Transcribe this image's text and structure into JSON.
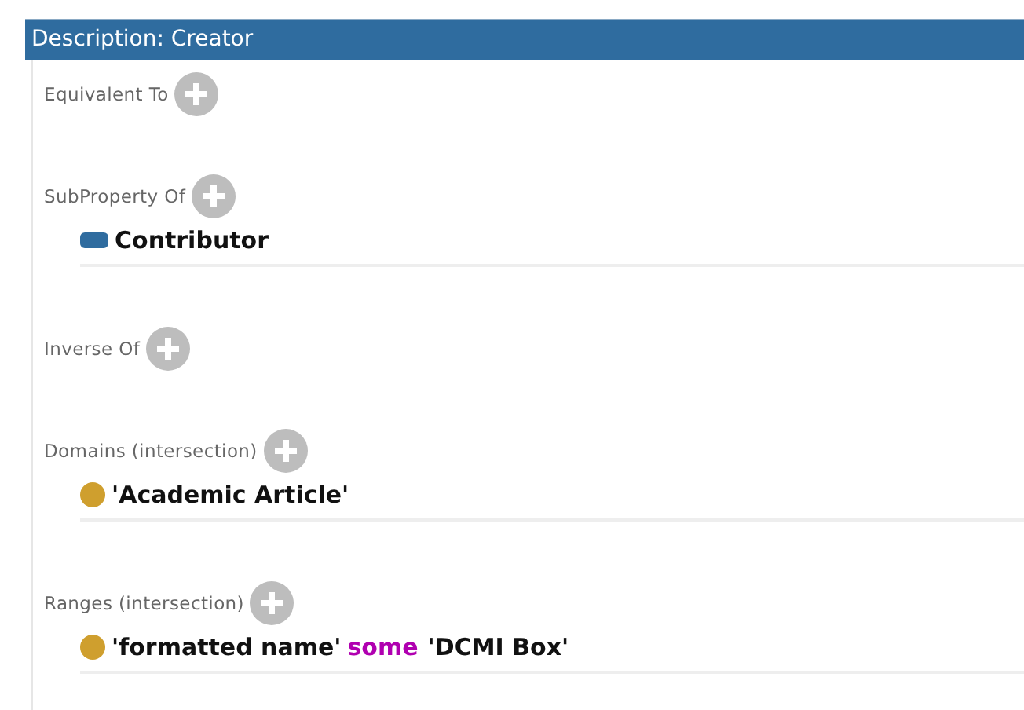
{
  "title": "Description: Creator",
  "sections": [
    {
      "label": "Equivalent To"
    },
    {
      "label": "SubProperty Of",
      "items": [
        {
          "kind": "property",
          "parts": [
            {
              "kind": "entity",
              "text": "Contributor"
            }
          ]
        }
      ]
    },
    {
      "label": "Inverse Of"
    },
    {
      "label": "Domains (intersection)",
      "items": [
        {
          "kind": "class",
          "parts": [
            {
              "kind": "entity",
              "text": "'Academic Article'"
            }
          ]
        }
      ]
    },
    {
      "label": "Ranges (intersection)",
      "items": [
        {
          "kind": "class",
          "parts": [
            {
              "kind": "entity",
              "text": "'formatted name'"
            },
            {
              "kind": "keyword",
              "text": "some"
            },
            {
              "kind": "entity",
              "text": "'DCMI Box'"
            }
          ]
        }
      ]
    }
  ]
}
